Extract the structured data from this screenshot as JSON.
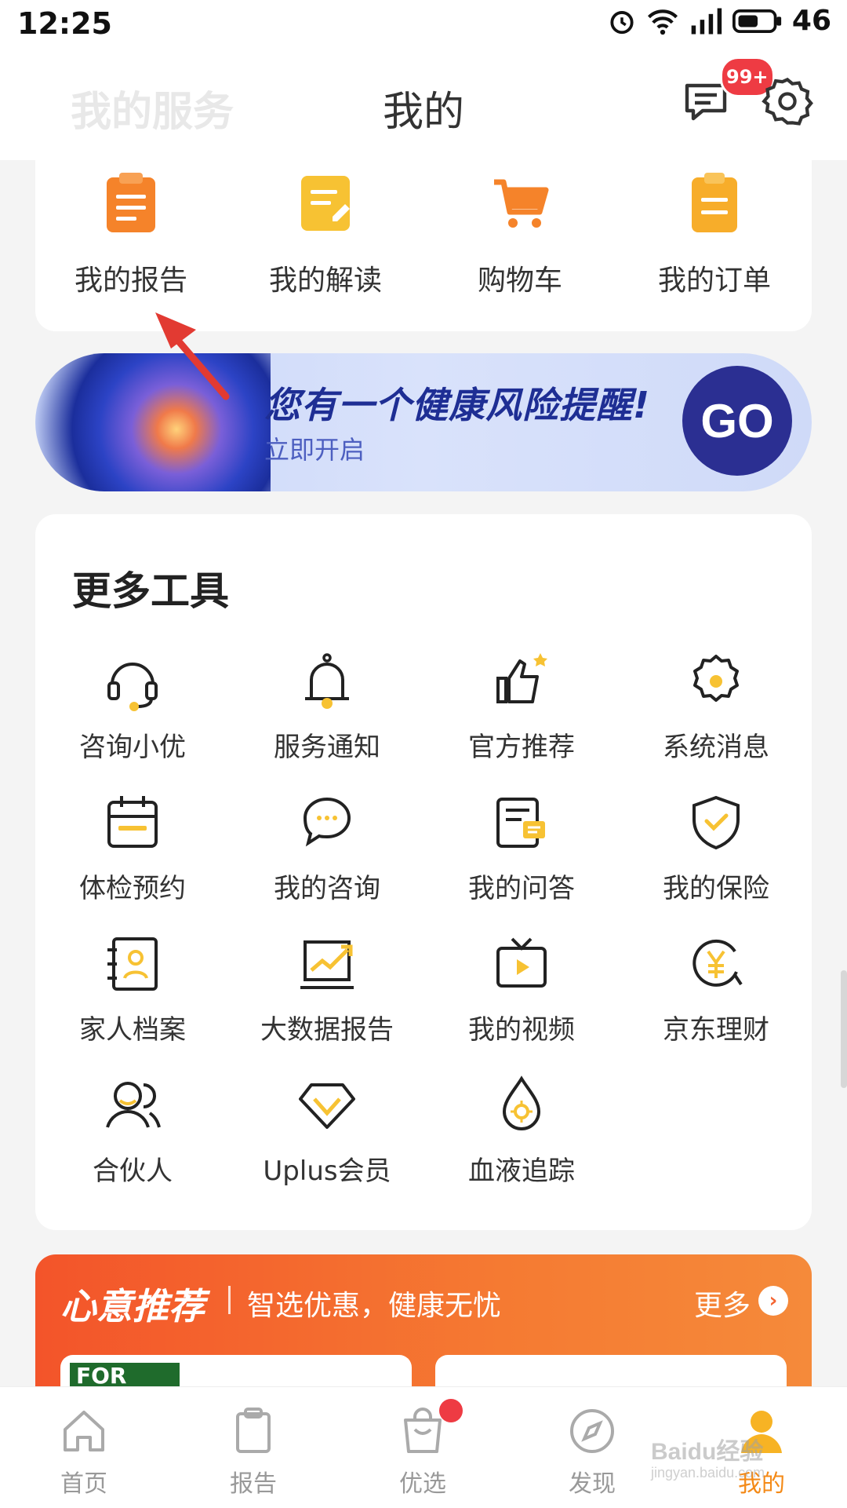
{
  "status_bar": {
    "time": "12:25",
    "battery": "46"
  },
  "header": {
    "faded_title": "我的服务",
    "title": "我的",
    "badge": "99+"
  },
  "services": [
    {
      "label": "我的报告",
      "icon": "report-clipboard-icon"
    },
    {
      "label": "我的解读",
      "icon": "note-edit-icon"
    },
    {
      "label": "购物车",
      "icon": "shopping-cart-icon"
    },
    {
      "label": "我的订单",
      "icon": "order-clipboard-icon"
    }
  ],
  "banner": {
    "headline": "您有一个健康风险提醒!",
    "sub": "立即开启",
    "go": "GO"
  },
  "tools": {
    "title": "更多工具",
    "items": [
      {
        "label": "咨询小优",
        "icon": "headset-icon"
      },
      {
        "label": "服务通知",
        "icon": "bell-icon"
      },
      {
        "label": "官方推荐",
        "icon": "thumbs-up-icon"
      },
      {
        "label": "系统消息",
        "icon": "gear-icon"
      },
      {
        "label": "体检预约",
        "icon": "calendar-icon"
      },
      {
        "label": "我的咨询",
        "icon": "chat-bubble-icon"
      },
      {
        "label": "我的问答",
        "icon": "qa-card-icon"
      },
      {
        "label": "我的保险",
        "icon": "shield-icon"
      },
      {
        "label": "家人档案",
        "icon": "family-profile-icon"
      },
      {
        "label": "大数据报告",
        "icon": "trend-chart-icon"
      },
      {
        "label": "我的视频",
        "icon": "tv-play-icon"
      },
      {
        "label": "京东理财",
        "icon": "yuan-coin-icon"
      },
      {
        "label": "合伙人",
        "icon": "partners-icon"
      },
      {
        "label": "Uplus会员",
        "icon": "diamond-icon"
      },
      {
        "label": "血液追踪",
        "icon": "blood-drop-icon"
      }
    ]
  },
  "recommend": {
    "title": "心意推荐",
    "subtitle": "智选优惠，健康无忧",
    "more": "更多",
    "brand_logo": "FOR"
  },
  "tabbar": [
    {
      "label": "首页",
      "icon": "home-icon"
    },
    {
      "label": "报告",
      "icon": "clipboard-icon"
    },
    {
      "label": "优选",
      "icon": "shopping-bag-icon"
    },
    {
      "label": "发现",
      "icon": "compass-icon"
    },
    {
      "label": "我的",
      "icon": "person-icon"
    }
  ],
  "watermark": {
    "brand": "Baidu经验",
    "url": "jingyan.baidu.com"
  },
  "colors": {
    "accent": "#f48a17",
    "badge": "#ee3b43",
    "banner_text": "#1e2e94",
    "recommend": "#f3542a"
  }
}
